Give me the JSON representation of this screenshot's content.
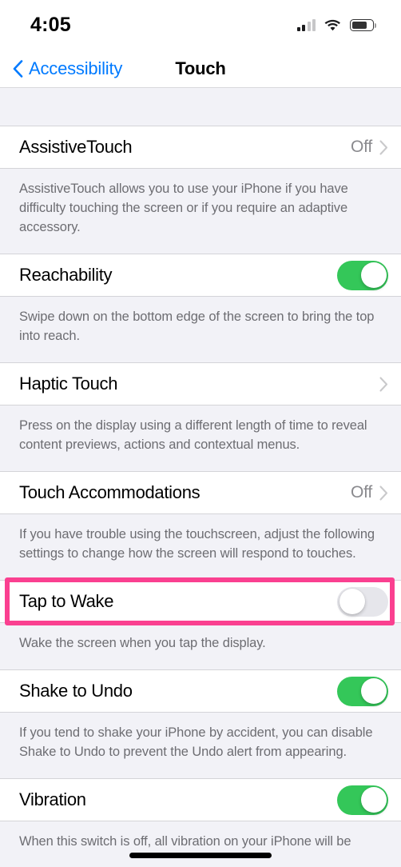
{
  "status_bar": {
    "time": "4:05",
    "signal_icon": "cellular-signal-icon",
    "signal_bars_filled": 2,
    "signal_bars_total": 4,
    "wifi_icon": "wifi-icon",
    "battery_icon": "battery-icon",
    "battery_level_percent": 66
  },
  "nav": {
    "back_label": "Accessibility",
    "back_icon": "chevron-left-icon",
    "title": "Touch"
  },
  "colors": {
    "accent_blue": "#007AFF",
    "toggle_on_green": "#34C759",
    "toggle_off_gray": "#E6E6EB",
    "highlight_pink": "#FA4090",
    "background_gray": "#F2F2F7",
    "row_white": "#FFFFFF",
    "secondary_text": "#6D6D72",
    "value_text": "#8A8A8E"
  },
  "sections": [
    {
      "row": {
        "label": "AssistiveTouch",
        "value": "Off",
        "control": "disclosure",
        "name": "assistive-touch"
      },
      "footer": "AssistiveTouch allows you to use your iPhone if you have difficulty touching the screen or if you require an adaptive accessory."
    },
    {
      "row": {
        "label": "Reachability",
        "value": "",
        "control": "toggle",
        "toggle_state": "on",
        "name": "reachability"
      },
      "footer": "Swipe down on the bottom edge of the screen to bring the top into reach."
    },
    {
      "row": {
        "label": "Haptic Touch",
        "value": "",
        "control": "disclosure",
        "name": "haptic-touch"
      },
      "footer": "Press on the display using a different length of time to reveal content previews, actions and contextual menus."
    },
    {
      "row": {
        "label": "Touch Accommodations",
        "value": "Off",
        "control": "disclosure",
        "name": "touch-accommodations"
      },
      "footer": "If you have trouble using the touchscreen, adjust the following settings to change how the screen will respond to touches."
    },
    {
      "row": {
        "label": "Tap to Wake",
        "value": "",
        "control": "toggle",
        "toggle_state": "off",
        "name": "tap-to-wake",
        "highlighted": true
      },
      "footer": "Wake the screen when you tap the display."
    },
    {
      "row": {
        "label": "Shake to Undo",
        "value": "",
        "control": "toggle",
        "toggle_state": "on",
        "name": "shake-to-undo"
      },
      "footer": "If you tend to shake your iPhone by accident, you can disable Shake to Undo to prevent the Undo alert from appearing."
    },
    {
      "row": {
        "label": "Vibration",
        "value": "",
        "control": "toggle",
        "toggle_state": "on",
        "name": "vibration"
      },
      "footer": "When this switch is off, all vibration on your iPhone will be"
    }
  ]
}
